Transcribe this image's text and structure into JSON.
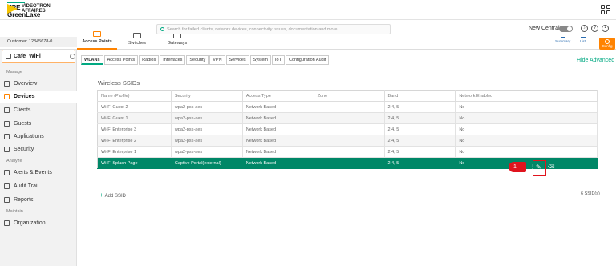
{
  "header": {
    "logo_line1": "HPE",
    "logo_line2": "GreenLake",
    "apps_icon": "grid-icon"
  },
  "brand": {
    "line1": "VIDEOTRON",
    "line2": "AFFAIRES"
  },
  "customer": "Customer: 12345678-0...",
  "search": {
    "placeholder": "Search for failed clients, network devices, connectivity issues, documentation and more"
  },
  "new_central": {
    "label": "New Central",
    "enabled": false
  },
  "header_icons": [
    "bell-icon",
    "help-icon",
    "user-icon"
  ],
  "top_tabs": [
    {
      "label": "Access Points",
      "icon": "access-point-icon",
      "active": true
    },
    {
      "label": "Switches",
      "icon": "switch-icon",
      "active": false
    },
    {
      "label": "Gateways",
      "icon": "gateway-icon",
      "active": false
    }
  ],
  "right_tools": [
    {
      "label": "Summary",
      "icon": "bar-chart-icon"
    },
    {
      "label": "List",
      "icon": "list-icon"
    },
    {
      "label": "Config",
      "icon": "gear-icon",
      "active": true
    }
  ],
  "group": "Cafe_WiFi",
  "sidebar": {
    "sections": [
      {
        "title": "Manage",
        "items": [
          {
            "label": "Overview",
            "icon": "overview-icon"
          },
          {
            "label": "Devices",
            "icon": "devices-icon",
            "active": true
          },
          {
            "label": "Clients",
            "icon": "clients-icon"
          },
          {
            "label": "Guests",
            "icon": "guests-icon"
          },
          {
            "label": "Applications",
            "icon": "applications-icon"
          },
          {
            "label": "Security",
            "icon": "security-icon"
          }
        ]
      },
      {
        "title": "Analyze",
        "items": [
          {
            "label": "Alerts & Events",
            "icon": "alert-icon"
          },
          {
            "label": "Audit Trail",
            "icon": "audit-icon"
          },
          {
            "label": "Reports",
            "icon": "reports-icon"
          }
        ]
      },
      {
        "title": "Maintain",
        "items": [
          {
            "label": "Organization",
            "icon": "organization-icon"
          }
        ]
      }
    ]
  },
  "sub_tabs": [
    "WLANs",
    "Access Points",
    "Radios",
    "Interfaces",
    "Security",
    "VPN",
    "Services",
    "System",
    "IoT",
    "Configuration Audit"
  ],
  "hide_advanced": "Hide Advanced",
  "wireless": {
    "title": "Wireless SSIDs",
    "columns": [
      "Name (Profile)",
      "Security",
      "Access Type",
      "Zone",
      "Band",
      "Network Enabled"
    ],
    "rows": [
      [
        "Wi-Fi Guest 2",
        "wpa2-psk-aes",
        "Network Based",
        "",
        "2.4, 5",
        "No"
      ],
      [
        "Wi-Fi Guest 1",
        "wpa2-psk-aes",
        "Network Based",
        "",
        "2.4, 5",
        "No"
      ],
      [
        "Wi-Fi Enterprise 3",
        "wpa2-psk-aes",
        "Network Based",
        "",
        "2.4, 5",
        "No"
      ],
      [
        "Wi-Fi Enterprise 2",
        "wpa2-psk-aes",
        "Network Based",
        "",
        "2.4, 5",
        "No"
      ],
      [
        "Wi-Fi Enterprise 1",
        "wpa2-psk-aes",
        "Network Based",
        "",
        "2.4, 5",
        "No"
      ],
      [
        "Wi-Fi Splash Page",
        "Captive Portal(external)",
        "Network Based",
        "",
        "2.4, 5",
        "No"
      ]
    ],
    "selected_row": 5,
    "add_label": "Add SSID",
    "count": "6 SSID(s)"
  },
  "annotation": {
    "step": "1"
  },
  "colors": {
    "accent": "#01a982",
    "orange": "#ff8300",
    "selected_row": "#008767",
    "callout_red": "#e0141e"
  }
}
